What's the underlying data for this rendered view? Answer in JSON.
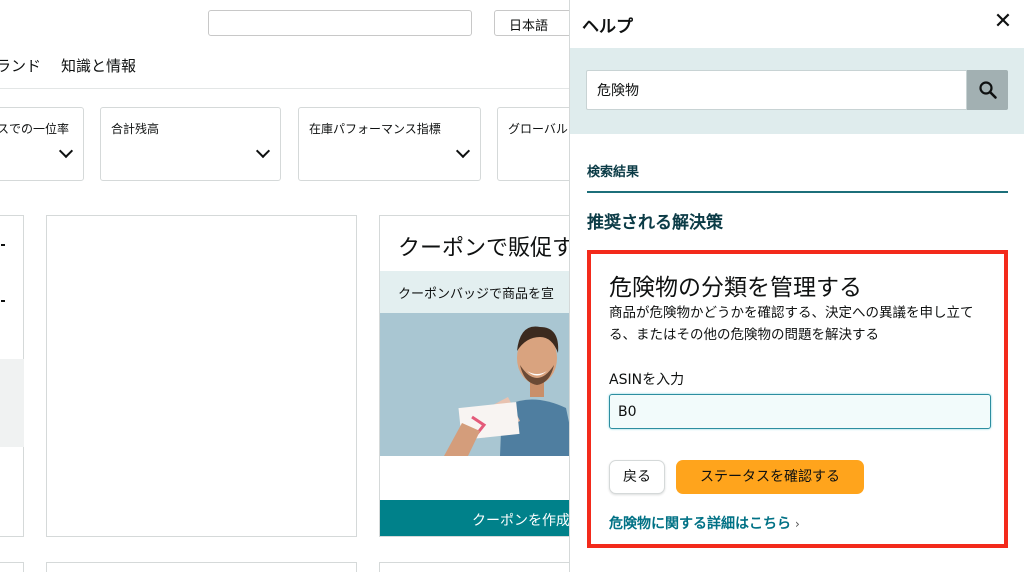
{
  "background": {
    "language_select": "日本語",
    "nav": [
      "ランド",
      "知識と情報"
    ],
    "metrics": [
      "スでの一位率",
      "合計残高",
      "在庫パフォーマンス指標",
      "グローバル"
    ],
    "coupon_card": {
      "title": "クーポンで販促す",
      "subtitle": "クーポンバッジで商品を宣",
      "button": "クーポンを作成"
    }
  },
  "help": {
    "title": "ヘルプ",
    "close_icon": "close-icon",
    "search_value": "危険物",
    "results_label": "検索結果",
    "recommended": "推奨される解決策",
    "solution": {
      "title": "危険物の分類を管理する",
      "description": "商品が危険物かどうかを確認する、決定への異議を申し立てる、またはその他の危険物の問題を解決する",
      "asin_label": "ASINを入力",
      "asin_value": "B0",
      "back_button": "戻る",
      "status_button": "ステータスを確認する",
      "detail_link": "危険物に関する詳細はこちら",
      "link_chevron": "›"
    }
  },
  "colors": {
    "accent_orange": "#ffa41c",
    "highlight_red": "#f32a1b",
    "teal": "#00818a",
    "link": "#007185"
  }
}
